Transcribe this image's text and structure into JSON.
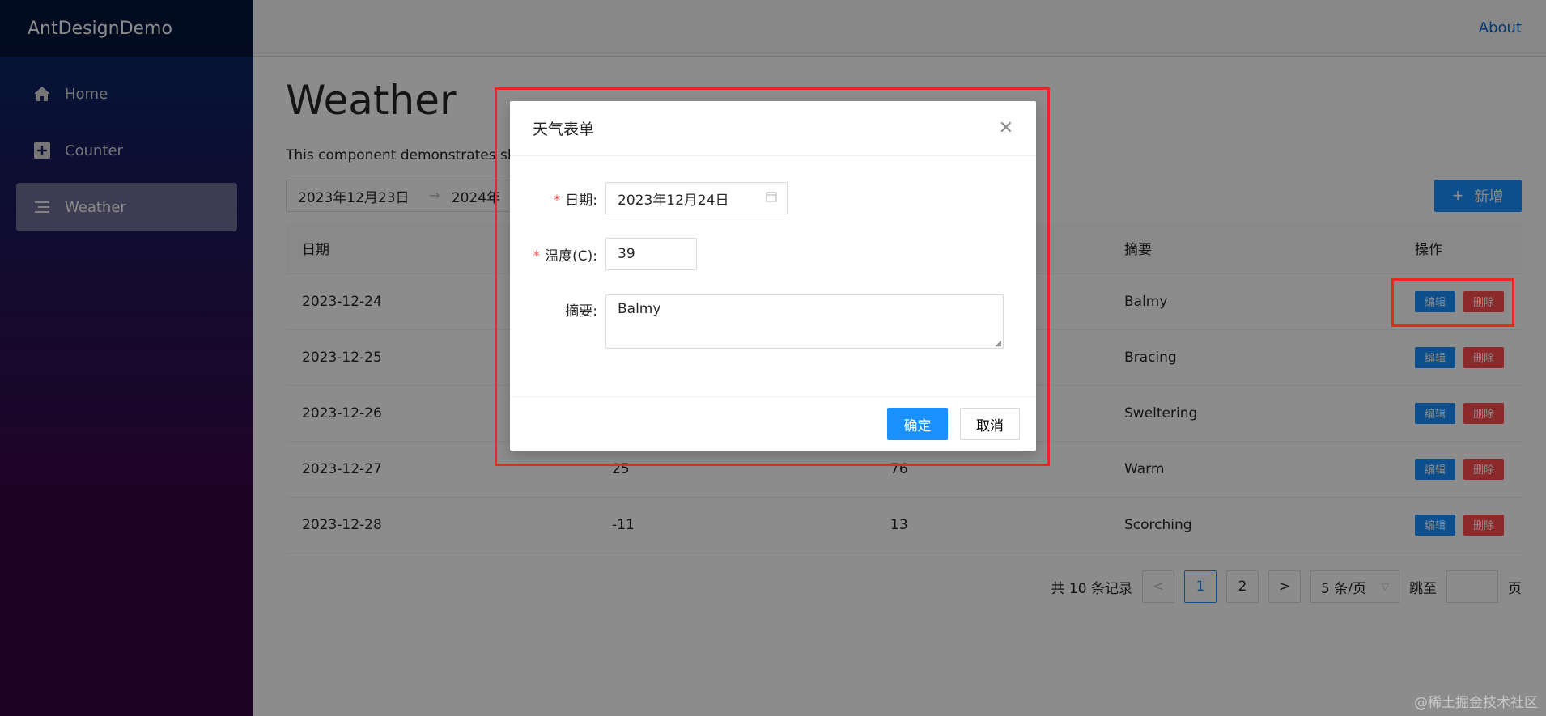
{
  "app": {
    "title": "AntDesignDemo"
  },
  "sidebar": {
    "items": [
      {
        "label": "Home",
        "icon": "home-icon"
      },
      {
        "label": "Counter",
        "icon": "plus-square-icon"
      },
      {
        "label": "Weather",
        "icon": "menu-icon"
      }
    ]
  },
  "topbar": {
    "about": "About"
  },
  "page": {
    "title": "Weather",
    "description": "This component demonstrates show",
    "range_start": "2023年12月23日",
    "range_end": "2024年",
    "add_button": "新增"
  },
  "table": {
    "headers": [
      "日期",
      "",
      "",
      "摘要",
      "操作"
    ],
    "rows": [
      {
        "date": "2023-12-24",
        "c": "",
        "f": "",
        "summary": "Balmy"
      },
      {
        "date": "2023-12-25",
        "c": "",
        "f": "",
        "summary": "Bracing"
      },
      {
        "date": "2023-12-26",
        "c": "",
        "f": "",
        "summary": "Sweltering"
      },
      {
        "date": "2023-12-27",
        "c": "25",
        "f": "76",
        "summary": "Warm"
      },
      {
        "date": "2023-12-28",
        "c": "-11",
        "f": "13",
        "summary": "Scorching"
      }
    ],
    "edit_label": "编辑",
    "delete_label": "删除"
  },
  "pagination": {
    "total": "共 10 条记录",
    "prev": "<",
    "pages": [
      "1",
      "2"
    ],
    "next": ">",
    "page_size": "5 条/页",
    "jump_label": "跳至",
    "page_suffix": "页"
  },
  "modal": {
    "title": "天气表单",
    "date_label": "日期:",
    "date_value": "2023年12月24日",
    "temp_label": "温度(C):",
    "temp_value": "39",
    "summary_label": "摘要:",
    "summary_value": "Balmy",
    "ok": "确定",
    "cancel": "取消"
  },
  "watermark": "@稀土掘金技术社区",
  "colors": {
    "primary": "#1890ff",
    "danger": "#ff4d4f",
    "highlight": "#e52b20"
  }
}
